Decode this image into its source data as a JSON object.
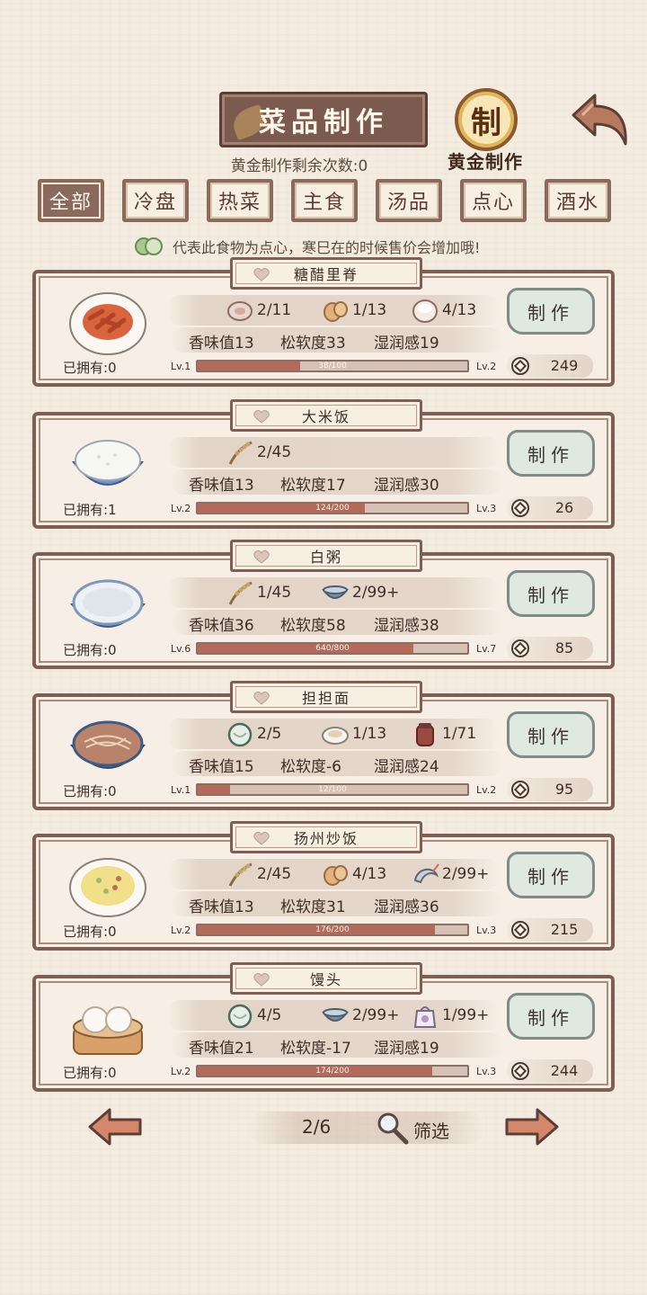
{
  "header": {
    "title": "菜品制作",
    "gold_remaining": "黄金制作剩余次数:0",
    "gold_seal_char": "制",
    "gold_label": "黄金制作"
  },
  "tabs": [
    {
      "label": "全部",
      "active": true
    },
    {
      "label": "冷盘",
      "active": false
    },
    {
      "label": "热菜",
      "active": false
    },
    {
      "label": "主食",
      "active": false
    },
    {
      "label": "汤品",
      "active": false
    },
    {
      "label": "点心",
      "active": false
    },
    {
      "label": "酒水",
      "active": false
    }
  ],
  "hint": "代表此食物为点心，寒巳在的时候售价会增加哦!",
  "make_label": "制作",
  "cards": [
    {
      "name": "糖醋里脊",
      "owned": "已拥有:0",
      "food_icon": "sweet-sour-pork-icon",
      "ingredients": [
        {
          "icon": "pork-icon",
          "count": "2/11"
        },
        {
          "icon": "egg-icon",
          "count": "1/13"
        },
        {
          "icon": "flour-icon",
          "count": "4/13"
        }
      ],
      "stats": {
        "aroma": "香味值13",
        "softness": "松软度33",
        "moisture": "湿润感19"
      },
      "lv": "Lv.1",
      "lv_next": "Lv.2",
      "progress_text": "38/100",
      "progress": 0.38,
      "price": "249"
    },
    {
      "name": "大米饭",
      "owned": "已拥有:1",
      "food_icon": "rice-bowl-icon",
      "ingredients": [
        {
          "icon": "rice-plant-icon",
          "count": "2/45"
        }
      ],
      "stats": {
        "aroma": "香味值13",
        "softness": "松软度17",
        "moisture": "湿润感30"
      },
      "lv": "Lv.2",
      "lv_next": "Lv.3",
      "progress_text": "124/200",
      "progress": 0.62,
      "price": "26"
    },
    {
      "name": "白粥",
      "owned": "已拥有:0",
      "food_icon": "porridge-bowl-icon",
      "ingredients": [
        {
          "icon": "rice-plant-icon",
          "count": "1/45"
        },
        {
          "icon": "water-bowl-icon",
          "count": "2/99+"
        }
      ],
      "stats": {
        "aroma": "香味值36",
        "softness": "松软度58",
        "moisture": "湿润感38"
      },
      "lv": "Lv.6",
      "lv_next": "Lv.7",
      "progress_text": "640/800",
      "progress": 0.8,
      "price": "85"
    },
    {
      "name": "担担面",
      "owned": "已拥有:0",
      "food_icon": "dandan-noodles-icon",
      "ingredients": [
        {
          "icon": "noodle-icon",
          "count": "2/5"
        },
        {
          "icon": "meat-plate-icon",
          "count": "1/13"
        },
        {
          "icon": "chili-oil-jar-icon",
          "count": "1/71"
        }
      ],
      "stats": {
        "aroma": "香味值15",
        "softness": "松软度-6",
        "moisture": "湿润感24"
      },
      "lv": "Lv.1",
      "lv_next": "Lv.2",
      "progress_text": "12/100",
      "progress": 0.12,
      "price": "95"
    },
    {
      "name": "扬州炒饭",
      "owned": "已拥有:0",
      "food_icon": "fried-rice-icon",
      "ingredients": [
        {
          "icon": "rice-plant-icon",
          "count": "2/45"
        },
        {
          "icon": "egg-icon",
          "count": "4/13"
        },
        {
          "icon": "shrimp-icon",
          "count": "2/99+"
        }
      ],
      "stats": {
        "aroma": "香味值13",
        "softness": "松软度31",
        "moisture": "湿润感36"
      },
      "lv": "Lv.2",
      "lv_next": "Lv.3",
      "progress_text": "176/200",
      "progress": 0.88,
      "price": "215"
    },
    {
      "name": "馒头",
      "owned": "已拥有:0",
      "food_icon": "steamed-bun-icon",
      "ingredients": [
        {
          "icon": "noodle-icon",
          "count": "4/5"
        },
        {
          "icon": "water-bowl-icon",
          "count": "2/99+"
        },
        {
          "icon": "sugar-bag-icon",
          "count": "1/99+"
        }
      ],
      "stats": {
        "aroma": "香味值21",
        "softness": "松软度-17",
        "moisture": "湿润感19"
      },
      "lv": "Lv.2",
      "lv_next": "Lv.3",
      "progress_text": "174/200",
      "progress": 0.87,
      "price": "244"
    }
  ],
  "footer": {
    "page": "2/6",
    "filter_label": "筛选"
  },
  "colors": {
    "background": "#f4ece1",
    "frame": "#7d5f55",
    "progress_fill": "#b46a5a",
    "make_button": "#dfe9e0"
  }
}
